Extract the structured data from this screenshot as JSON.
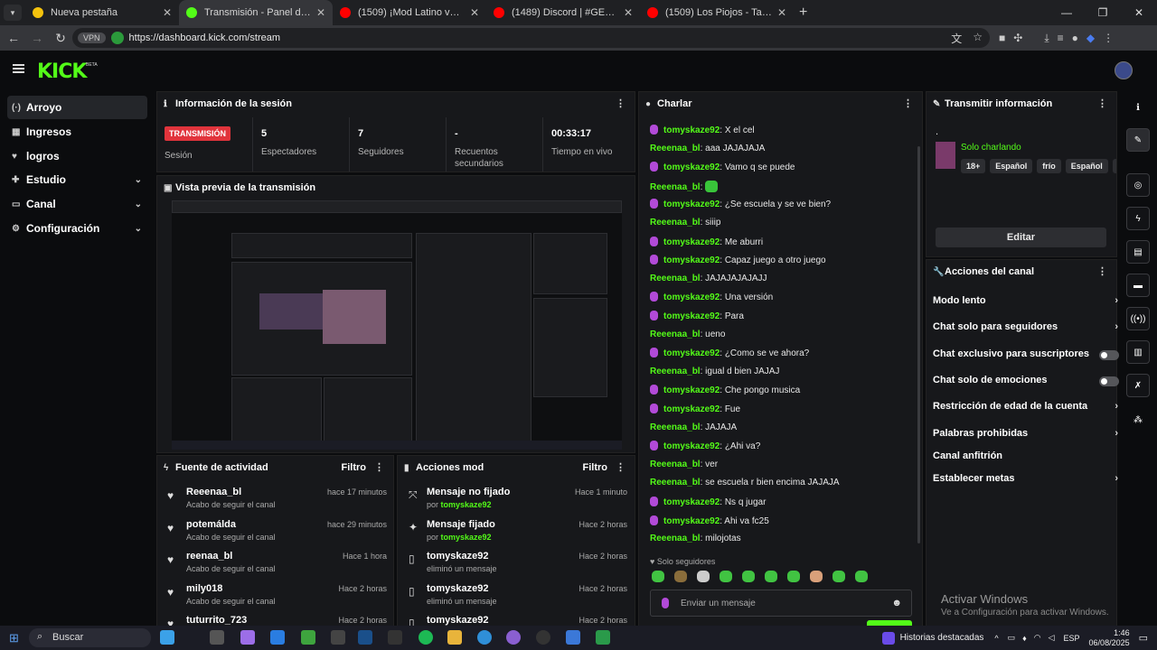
{
  "browser": {
    "tabs": [
      {
        "title": "Nueva pestaña",
        "color": "#f4c20d"
      },
      {
        "title": "Transmisión - Panel de control de",
        "color": "#53fc18"
      },
      {
        "title": "(1509) ¡Mod Latino v2.1 para Spi",
        "color": "#ff0000"
      },
      {
        "title": "(1489) Discord | #GENERAL-STR",
        "color": "#ff0000"
      },
      {
        "title": "(1509) Los Piojos - Tan solo (Co",
        "color": "#ff0000"
      }
    ],
    "url": "https://dashboard.kick.com/stream",
    "vpn_label": "VPN"
  },
  "kick": {
    "logo": "KICK",
    "beta": "BETA"
  },
  "sidebar": {
    "items": [
      {
        "label": "Arroyo",
        "icon": "stream-icon"
      },
      {
        "label": "Ingresos",
        "icon": "revenue-icon"
      },
      {
        "label": "logros",
        "icon": "trophy-icon"
      },
      {
        "label": "Estudio",
        "icon": "studio-icon"
      },
      {
        "label": "Canal",
        "icon": "channel-icon"
      },
      {
        "label": "Configuración",
        "icon": "gear-icon"
      }
    ]
  },
  "session": {
    "title": "Información de la sesión",
    "badge": "TRANSMISIÓN",
    "session_label": "Sesión",
    "stats": [
      {
        "value": "5",
        "label": "Espectadores"
      },
      {
        "value": "7",
        "label": "Seguidores"
      },
      {
        "value": "-",
        "label": "Recuentos secundarios"
      },
      {
        "value": "00:33:17",
        "label": "Tiempo en vivo"
      }
    ]
  },
  "preview": {
    "title": "Vista previa de la transmisión"
  },
  "activity": {
    "title": "Fuente de actividad",
    "filter": "Filtro",
    "rows": [
      {
        "name": "Reeenaa_bl",
        "sub": "Acabo de seguir el canal",
        "time": "hace 17 minutos"
      },
      {
        "name": "potemálda",
        "sub": "Acabo de seguir el canal",
        "time": "hace 29 minutos"
      },
      {
        "name": "reenaa_bl",
        "sub": "Acabo de seguir el canal",
        "time": "Hace 1 hora"
      },
      {
        "name": "mily018",
        "sub": "Acabo de seguir el canal",
        "time": "Hace 2 horas"
      },
      {
        "name": "tuturrito_723",
        "sub": "",
        "time": "Hace 2 horas"
      }
    ]
  },
  "mod": {
    "title": "Acciones mod",
    "filter": "Filtro",
    "rows": [
      {
        "name": "Mensaje no fijado",
        "pre": "por ",
        "user": "tomyskaze92",
        "sub": "",
        "time": "Hace 1 minuto",
        "icon": "unpin-icon"
      },
      {
        "name": "Mensaje fijado",
        "pre": "por ",
        "user": "tomyskaze92",
        "sub": "",
        "time": "Hace 2 horas",
        "icon": "pin-icon"
      },
      {
        "name": "tomyskaze92",
        "pre": "",
        "user": "",
        "sub": "eliminó un mensaje",
        "time": "Hace 2 horas",
        "icon": "trash-icon"
      },
      {
        "name": "tomyskaze92",
        "pre": "",
        "user": "",
        "sub": "eliminó un mensaje",
        "time": "Hace 2 horas",
        "icon": "trash-icon"
      },
      {
        "name": "tomyskaze92",
        "pre": "",
        "user": "",
        "sub": "",
        "time": "Hace 2 horas",
        "icon": "trash-icon"
      }
    ]
  },
  "chat": {
    "title": "Charlar",
    "messages": [
      {
        "user": "tomyskaze92",
        "text": "X el cel",
        "mic": true
      },
      {
        "user": "Reeenaa_bl",
        "text": "aaa JAJAJAJA",
        "mic": false
      },
      {
        "user": "tomyskaze92",
        "text": "Vamo q se puede",
        "mic": true
      },
      {
        "user": "Reeenaa_bl",
        "text": "",
        "mic": false,
        "emote": true
      },
      {
        "user": "tomyskaze92",
        "text": "¿Se escuela y se ve bien?",
        "mic": true
      },
      {
        "user": "Reeenaa_bl",
        "text": "siiip",
        "mic": false
      },
      {
        "user": "tomyskaze92",
        "text": "Me aburri",
        "mic": true
      },
      {
        "user": "tomyskaze92",
        "text": "Capaz juego a otro juego",
        "mic": true
      },
      {
        "user": "Reeenaa_bl",
        "text": "JAJAJAJAJAJJ",
        "mic": false
      },
      {
        "user": "tomyskaze92",
        "text": "Una versión",
        "mic": true
      },
      {
        "user": "tomyskaze92",
        "text": "Para",
        "mic": true
      },
      {
        "user": "Reeenaa_bl",
        "text": "ueno",
        "mic": false
      },
      {
        "user": "tomyskaze92",
        "text": "¿Como se ve ahora?",
        "mic": true
      },
      {
        "user": "Reeenaa_bl",
        "text": "igual d bien JAJAJ",
        "mic": false
      },
      {
        "user": "tomyskaze92",
        "text": "Che pongo musica",
        "mic": true
      },
      {
        "user": "tomyskaze92",
        "text": "Fue",
        "mic": true
      },
      {
        "user": "Reeenaa_bl",
        "text": "JAJAJA",
        "mic": false
      },
      {
        "user": "tomyskaze92",
        "text": "¿Ahi va?",
        "mic": true
      },
      {
        "user": "Reeenaa_bl",
        "text": "ver",
        "mic": false
      },
      {
        "user": "Reeenaa_bl",
        "text": "se escuela r bien encima JAJAJA",
        "mic": false
      },
      {
        "user": "tomyskaze92",
        "text": "Ns q jugar",
        "mic": true
      },
      {
        "user": "tomyskaze92",
        "text": "Ahi va fc25",
        "mic": true
      },
      {
        "user": "Reeenaa_bl",
        "text": "milojotas",
        "mic": false
      }
    ],
    "followers_only": "Solo seguidores",
    "input_placeholder": "Enviar un mensaje"
  },
  "stream_info": {
    "title": "Transmitir información",
    "dot": ".",
    "category": "Solo charlando",
    "tags": [
      "18+",
      "Español",
      "frío",
      "Español",
      "j"
    ],
    "edit": "Editar"
  },
  "channel_actions": {
    "title": "Acciones del canal",
    "items": [
      {
        "label": "Modo lento",
        "type": "arrow"
      },
      {
        "label": "Chat solo para seguidores",
        "type": "arrow"
      },
      {
        "label": "Chat exclusivo para suscriptores",
        "type": "toggle"
      },
      {
        "label": "Chat solo de emociones",
        "type": "toggle"
      },
      {
        "label": "Restricción de edad de la cuenta",
        "type": "arrow"
      },
      {
        "label": "Palabras prohibidas",
        "type": "arrow"
      },
      {
        "label": "Canal anfitrión",
        "type": "none"
      },
      {
        "label": "Establecer metas",
        "type": "arrow"
      }
    ]
  },
  "windows": {
    "activate_title": "Activar Windows",
    "activate_sub": "Ve a Configuración para activar Windows.",
    "search": "Buscar",
    "news": "Historias destacadas",
    "lang": "ESP",
    "time": "1:46",
    "date": "06/08/2025"
  },
  "colors": {
    "accent": "#53fc18",
    "live": "#e1343c",
    "panel": "#17181b"
  }
}
